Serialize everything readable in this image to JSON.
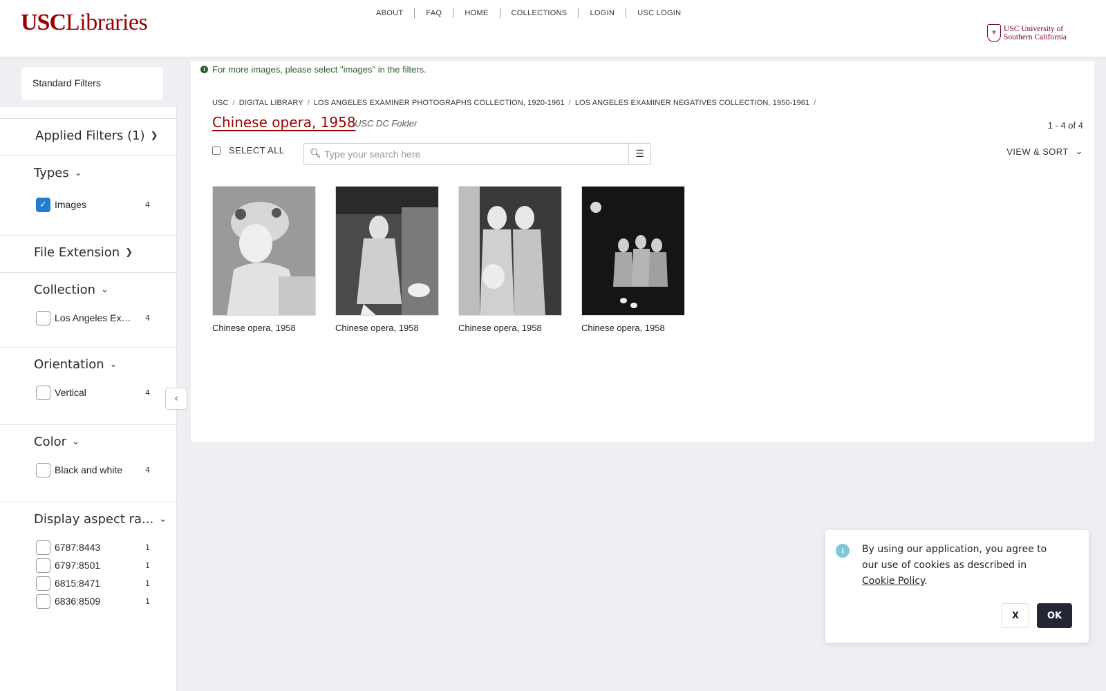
{
  "header": {
    "logo_usc": "USC",
    "logo_libraries": "Libraries",
    "nav": [
      "ABOUT",
      "FAQ",
      "HOME",
      "COLLECTIONS",
      "LOGIN",
      "USC LOGIN"
    ],
    "uni_logo_line1": "USC University of",
    "uni_logo_line2": "Southern California"
  },
  "sidebar": {
    "standard_filters": "Standard Filters",
    "applied_filters": "Applied Filters (1)",
    "types": {
      "title": "Types",
      "items": [
        {
          "label": "Images",
          "count": "4",
          "checked": true
        }
      ]
    },
    "file_extension": {
      "title": "File Extension"
    },
    "collection": {
      "title": "Collection",
      "items": [
        {
          "label": "Los Angeles Examiner Photographs Collection, 1920-1961",
          "count": "4"
        }
      ]
    },
    "orientation": {
      "title": "Orientation",
      "items": [
        {
          "label": "Vertical",
          "count": "4"
        }
      ]
    },
    "color": {
      "title": "Color",
      "items": [
        {
          "label": "Black and white",
          "count": "4"
        }
      ]
    },
    "aspect": {
      "title": "Display aspect ra...",
      "items": [
        {
          "label": "6787:8443",
          "count": "1"
        },
        {
          "label": "6797:8501",
          "count": "1"
        },
        {
          "label": "6815:8471",
          "count": "1"
        },
        {
          "label": "6836:8509",
          "count": "1"
        }
      ]
    }
  },
  "main": {
    "notice": "For more images, please select \"images\" in the filters.",
    "breadcrumb": [
      "USC",
      "DIGITAL LIBRARY",
      "LOS ANGELES EXAMINER PHOTOGRAPHS COLLECTION, 1920-1961",
      "LOS ANGELES EXAMINER NEGATIVES COLLECTION, 1950-1961"
    ],
    "title": "Chinese opera, 1958",
    "folder_type": "USC DC Folder",
    "result_count": "1 - 4 of 4",
    "select_all": "SELECT ALL",
    "search_placeholder": "Type your search here",
    "view_sort": "VIEW & SORT",
    "items": [
      {
        "title": "Chinese opera, 1958"
      },
      {
        "title": "Chinese opera, 1958"
      },
      {
        "title": "Chinese opera, 1958"
      },
      {
        "title": "Chinese opera, 1958"
      }
    ]
  },
  "cookie": {
    "text": "By using our application, you agree to our use of cookies as described in",
    "link": "Cookie Policy",
    "after": ".",
    "dismiss": "X",
    "ok": "OK"
  }
}
